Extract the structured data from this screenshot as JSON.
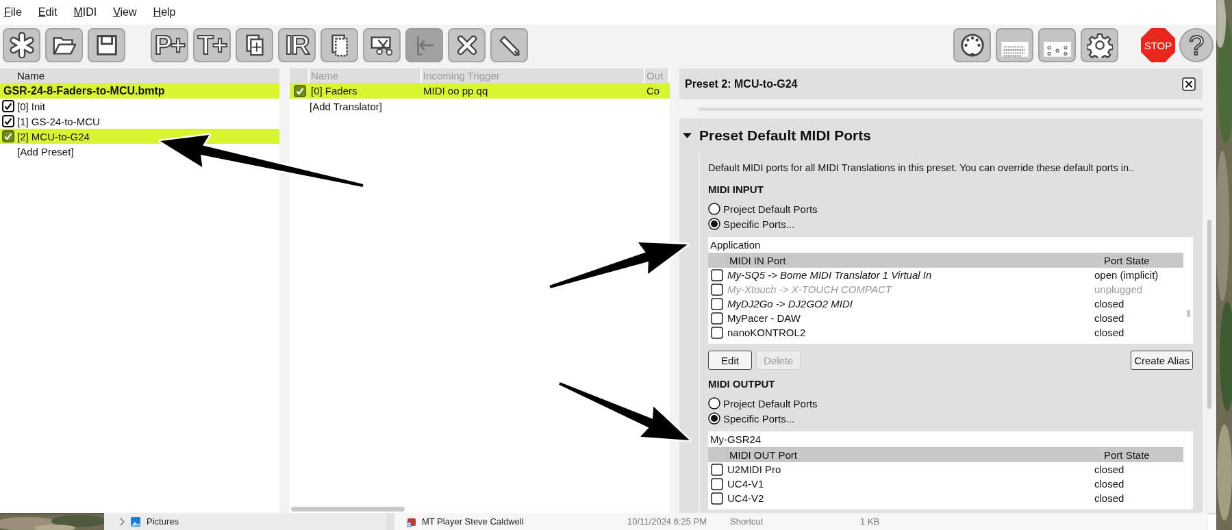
{
  "menu": [
    {
      "label": "File"
    },
    {
      "label": "Edit"
    },
    {
      "label": "MIDI"
    },
    {
      "label": "View"
    },
    {
      "label": "Help"
    }
  ],
  "toolbar": {
    "file_group": [
      {
        "kind": "asterisk",
        "disabled": false
      },
      {
        "kind": "folder",
        "disabled": false
      },
      {
        "kind": "disk",
        "disabled": false
      }
    ],
    "edit_group": [
      {
        "kind": "text",
        "label": "P+",
        "disabled": false
      },
      {
        "kind": "text",
        "label": "T+",
        "disabled": false
      },
      {
        "kind": "copy",
        "disabled": false
      },
      {
        "kind": "text",
        "label": "IR",
        "disabled": false
      },
      {
        "kind": "paste",
        "disabled": false
      },
      {
        "kind": "cut",
        "disabled": false
      },
      {
        "kind": "back",
        "disabled": true
      },
      {
        "kind": "delete",
        "disabled": false
      },
      {
        "kind": "pencil",
        "disabled": false
      }
    ],
    "settings_group": [
      {
        "kind": "midi",
        "disabled": false
      },
      {
        "kind": "keyboard",
        "disabled": false
      },
      {
        "kind": "ports",
        "disabled": false
      },
      {
        "kind": "gear",
        "disabled": false
      }
    ],
    "run_group": [
      {
        "kind": "stop",
        "label": "STOP",
        "disabled": false
      },
      {
        "kind": "help",
        "label": "?",
        "disabled": false
      }
    ]
  },
  "project": {
    "header": "Name",
    "name": "GSR-24-8-Faders-to-MCU.bmtp",
    "presets": [
      {
        "label": "[0] Init",
        "enabled": true,
        "selected": false
      },
      {
        "label": "[1] GS-24-to-MCU",
        "enabled": true,
        "selected": false
      },
      {
        "label": "[2] MCU-to-G24",
        "enabled": true,
        "selected": true
      }
    ],
    "add": "[Add Preset]"
  },
  "translators": {
    "columns": [
      "Name",
      "Incoming Trigger",
      "Out"
    ],
    "rows": [
      {
        "label": "[0] Faders",
        "trigger": "MIDI oo pp qq",
        "output": "Co",
        "enabled": true,
        "selected": true
      }
    ],
    "add": "[Add Translator]"
  },
  "editor": {
    "title": "Preset 2: MCU-to-G24",
    "section": {
      "title": "Preset Default MIDI Ports",
      "expanded": true,
      "description": "Default MIDI ports for all MIDI Translations in this preset. You can override these default ports in..",
      "input": {
        "heading": "MIDI INPUT",
        "options": [
          {
            "label": "Project Default Ports",
            "selected": false
          },
          {
            "label": "Specific Ports...",
            "selected": true
          }
        ],
        "selection": "Application",
        "columns": [
          "MIDI IN Port",
          "Port State"
        ],
        "ports": [
          {
            "name": "My-SQ5 -> Bome MIDI Translator 1 Virtual In",
            "state": "open (implicit)",
            "checked": false,
            "italic": true,
            "unplugged": false
          },
          {
            "name": "My-Xtouch -> X-TOUCH COMPACT",
            "state": "unplugged",
            "checked": false,
            "italic": true,
            "unplugged": true
          },
          {
            "name": "MyDJ2Go -> DJ2GO2 MIDI",
            "state": "closed",
            "checked": false,
            "italic": true,
            "unplugged": false
          },
          {
            "name": "MyPacer - DAW",
            "state": "closed",
            "checked": false,
            "italic": false,
            "unplugged": false
          },
          {
            "name": "nanoKONTROL2",
            "state": "closed",
            "checked": false,
            "italic": false,
            "unplugged": false
          }
        ],
        "buttons": [
          {
            "label": "Edit",
            "disabled": false
          },
          {
            "label": "Delete",
            "disabled": true
          },
          {
            "label": "Create Alias",
            "disabled": false
          }
        ]
      },
      "output": {
        "heading": "MIDI OUTPUT",
        "options": [
          {
            "label": "Project Default Ports",
            "selected": false
          },
          {
            "label": "Specific Ports...",
            "selected": true
          }
        ],
        "selection": "My-GSR24",
        "columns": [
          "MIDI OUT Port",
          "Port State"
        ],
        "ports": [
          {
            "name": "U2MIDI Pro",
            "state": "closed",
            "checked": false,
            "italic": false,
            "unplugged": false
          },
          {
            "name": "UC4-V1",
            "state": "closed",
            "checked": false,
            "italic": false,
            "unplugged": false
          },
          {
            "name": "UC4-V2",
            "state": "closed",
            "checked": false,
            "italic": false,
            "unplugged": false
          }
        ]
      }
    }
  },
  "explorer": {
    "nav_item": "Pictures",
    "file": {
      "name": "MT Player Steve Caldwell",
      "modified": "10/11/2024 6:25 PM",
      "type": "Shortcut",
      "size": "1 KB"
    }
  }
}
